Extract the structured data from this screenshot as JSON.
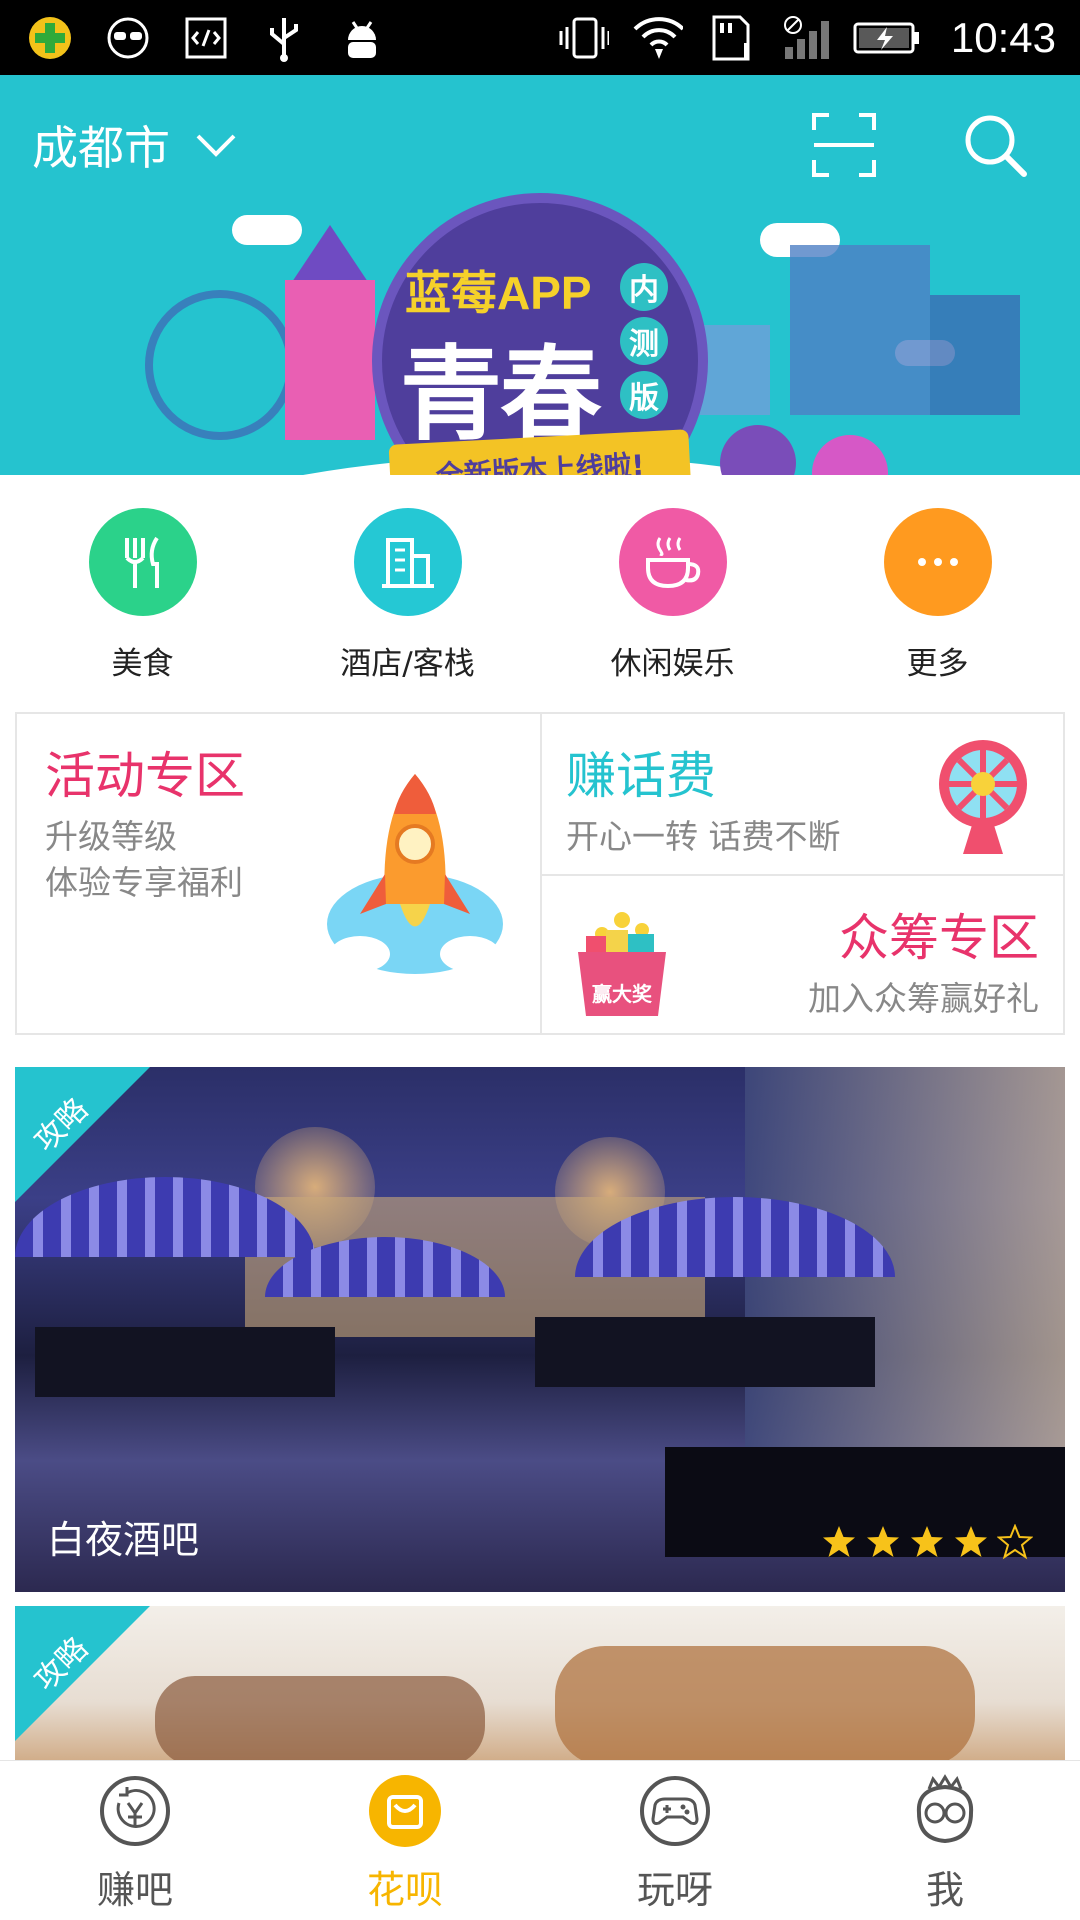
{
  "status_bar": {
    "time": "10:43",
    "left_icons": [
      "plus-shield-icon",
      "sunglasses-icon",
      "code-icon",
      "usb-icon",
      "android-icon"
    ],
    "right_icons": [
      "vibrate-icon",
      "wifi-icon",
      "sdcard-icon",
      "no-signal-icon",
      "battery-charging-icon"
    ]
  },
  "header": {
    "city": "成都市"
  },
  "banner": {
    "title_sub": "蓝莓APP",
    "title_main": "青春",
    "tags": [
      "内",
      "测",
      "版"
    ],
    "ribbon": "全新版本上线啦!",
    "dots": 3,
    "active_dot": 0
  },
  "categories": [
    {
      "label": "美食",
      "icon": "fork-knife-icon",
      "color": "#2bd28a"
    },
    {
      "label": "酒店/客栈",
      "icon": "building-icon",
      "color": "#25c8d4"
    },
    {
      "label": "休闲娱乐",
      "icon": "coffee-cup-icon",
      "color": "#f05aa5"
    },
    {
      "label": "更多",
      "icon": "more-icon",
      "color": "#ff9a1f"
    }
  ],
  "promo": {
    "activity": {
      "title": "活动专区",
      "line1": "升级等级",
      "line2": "体验专享福利",
      "color": "#e8336b"
    },
    "phone_fee": {
      "title": "赚话费",
      "subtitle": "开心一转 话费不断",
      "color": "#25c3cf"
    },
    "crowdfunding": {
      "title": "众筹专区",
      "subtitle": "加入众筹赢好礼",
      "color": "#e8336b",
      "badge": "赢大奖"
    }
  },
  "cards": [
    {
      "tag": "攻略",
      "title": "白夜酒吧",
      "rating": 4,
      "max_rating": 5
    },
    {
      "tag": "攻略",
      "title": ""
    }
  ],
  "nav": [
    {
      "label": "赚吧",
      "icon": "yuan-refresh-icon",
      "active": false
    },
    {
      "label": "花呗",
      "icon": "bag-icon",
      "active": true
    },
    {
      "label": "玩呀",
      "icon": "gamepad-icon",
      "active": false
    },
    {
      "label": "我",
      "icon": "profile-face-icon",
      "active": false
    }
  ],
  "colors": {
    "accent": "#25c3cf",
    "active_nav": "#f7b500"
  }
}
